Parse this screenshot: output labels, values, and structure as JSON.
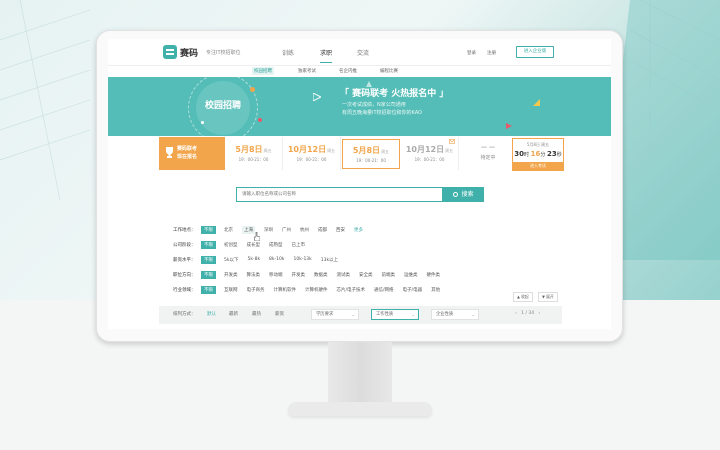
{
  "header": {
    "logo": "赛码",
    "slogan": "专注IT校招职位",
    "nav": [
      "训练",
      "求职",
      "交流"
    ],
    "active_nav": "求职",
    "login": "登录",
    "register": "注册",
    "enterprise": "进入企业版"
  },
  "subnav": [
    "校园招聘",
    "独家考试",
    "名企内推",
    "编程比赛"
  ],
  "banner": {
    "title": "校园招聘",
    "headline": "「 赛码联考  火热报名中 」",
    "line1": "一次考试成绩，N家公司通用",
    "line2": "有周五晚海量IT校招职位和你的KAO"
  },
  "contest": {
    "signup_line1": "赛码联考",
    "signup_line2": "现在报名",
    "dates": [
      {
        "date": "5月8日",
        "week": "周五",
        "time": "19：00-21：00"
      },
      {
        "date": "10月12日",
        "week": "周五",
        "time": "19：00-21：00"
      },
      {
        "date": "5月8日",
        "week": "周五",
        "time": "19：00-21：00"
      },
      {
        "date": "10月12日",
        "week": "周五",
        "time": "19：00-21：00"
      },
      {
        "date": "— —",
        "week": "",
        "time": "待定中"
      }
    ],
    "countdown": {
      "date": "5月8日 周五",
      "days": "30",
      "hours": "16",
      "mins": "23",
      "unit_d": "时",
      "unit_h": "分",
      "unit_m": "秒",
      "button": "进入考试"
    }
  },
  "search": {
    "placeholder": "请输入职位名称或公司名称",
    "button": "搜索"
  },
  "filters": [
    {
      "label": "工作地点：",
      "options": [
        "不限",
        "北京",
        "上海",
        "深圳",
        "广州",
        "杭州",
        "成都",
        "西安",
        "更多"
      ]
    },
    {
      "label": "公司阶段：",
      "options": [
        "不限",
        "初创型",
        "成长型",
        "成熟型",
        "已上市"
      ]
    },
    {
      "label": "薪资水平：",
      "options": [
        "不限",
        "5k以下",
        "5k-8k",
        "8k-10k",
        "10k-13k",
        "13k以上"
      ]
    },
    {
      "label": "职位方向：",
      "options": [
        "不限",
        "开发类",
        "算法类",
        "移动端",
        "开发类",
        "数据类",
        "测试类",
        "安全类",
        "前端类",
        "运维类",
        "硬件类"
      ]
    },
    {
      "label": "行业领域：",
      "options": [
        "不限",
        "互联网",
        "电子商务",
        "计算机软件",
        "计算机硬件",
        "芯片/电子技术",
        "通信/网络",
        "电子/电器",
        "其他"
      ]
    }
  ],
  "toggles": {
    "collapse": "▲ 收起",
    "expand": "▼ 展开"
  },
  "sortbar": {
    "label": "排列方式：",
    "options": [
      "默认",
      "最新",
      "最热",
      "薪资"
    ],
    "selects": [
      "学历要求",
      "工作性质",
      "企业性质"
    ],
    "pager": {
      "prev": "‹",
      "current": "1",
      "sep": "/",
      "total": "34",
      "next": "›"
    }
  },
  "colors": {
    "accent": "#3fb1aa",
    "banner": "#55bdb7",
    "orange": "#f2a54a"
  }
}
